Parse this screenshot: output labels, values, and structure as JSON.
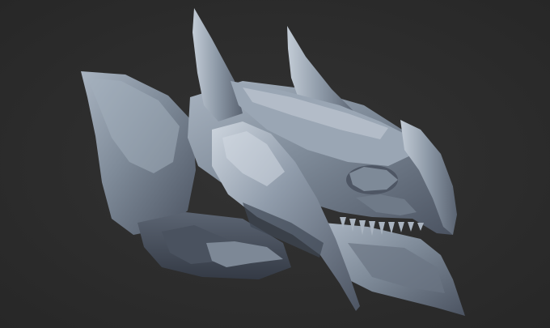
{
  "viewport": {
    "background": "#2d2d2d",
    "model": {
      "name": "creature-head-sculpt",
      "material_color": "#8c99a8",
      "shadow_color": "#3a4250",
      "highlight_color": "#c9d2dc"
    }
  }
}
